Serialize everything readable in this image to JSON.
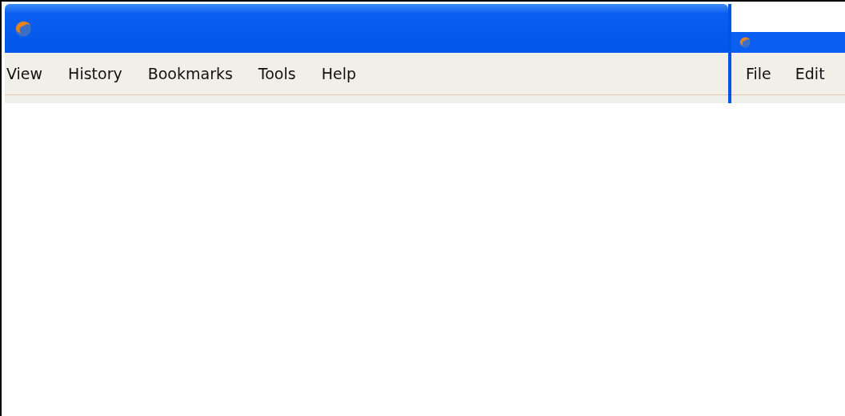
{
  "windows": [
    {
      "kind": "back",
      "menu": [
        {
          "label": "View"
        },
        {
          "label": "History"
        },
        {
          "label": "Bookmarks"
        },
        {
          "label": "Tools"
        },
        {
          "label": "Help"
        }
      ]
    },
    {
      "kind": "front",
      "menu": [
        {
          "label": "File"
        },
        {
          "label": "Edit"
        }
      ]
    }
  ]
}
